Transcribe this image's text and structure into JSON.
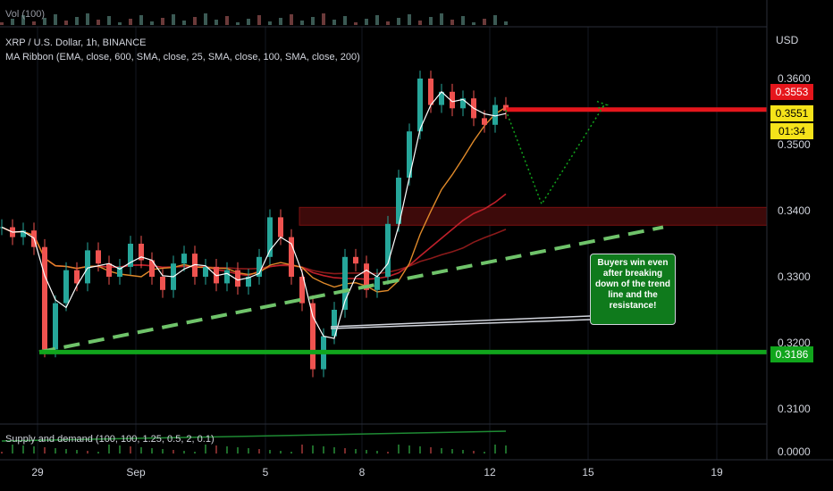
{
  "volume_label": "Vol (100)",
  "symbol_title": "XRP / U.S. Dollar, 1h, BINANCE",
  "indicator_title": "MA Ribbon (EMA, close, 600, SMA, close, 25, SMA, close, 100, SMA, close, 200)",
  "currency": "USD",
  "supply_demand_label": "Supply and demand (100, 100, 1.25, 0.5, 2, 0.1)",
  "annotation_text": "Buyers win even after breaking down of the trend line and the resistance!",
  "price_badges": {
    "resistance": "0.3553",
    "last": "0.3551",
    "countdown": "01:34",
    "support": "0.3186"
  },
  "colors": {
    "resistance": "#e5161c",
    "support": "#11a51c",
    "last_price": "#f5e31a",
    "zone": "#3d0a0a",
    "callout": "#0f7a1c"
  },
  "chart_data": {
    "type": "candlestick",
    "y_axis": {
      "ticks": [
        0.36,
        0.35,
        0.34,
        0.33,
        0.32,
        0.31
      ],
      "tick_labels": [
        "0.3600",
        "0.3500",
        "0.3400",
        "0.3300",
        "0.3200",
        "0.3100"
      ],
      "range": [
        0.3065,
        0.3625
      ]
    },
    "x_axis": {
      "tick_labels": [
        "29",
        "Sep",
        "5",
        "8",
        "12",
        "15",
        "19"
      ]
    },
    "sub_pane_tick": "0.0000",
    "levels": {
      "resistance": 0.3553,
      "support": 0.3186,
      "zone": [
        0.3378,
        0.3405
      ]
    },
    "trend_line": {
      "from": [
        "Aug 29",
        0.3186
      ],
      "to": [
        "Sep 16",
        0.3375
      ]
    },
    "projection": [
      [
        "Sep 12",
        0.3552
      ],
      [
        "Sep 14",
        0.341
      ],
      [
        "Sep 16",
        0.356
      ]
    ],
    "price_series": [
      0.3375,
      0.336,
      0.337,
      0.3345,
      0.319,
      0.326,
      0.331,
      0.329,
      0.334,
      0.332,
      0.33,
      0.3315,
      0.335,
      0.3325,
      0.33,
      0.328,
      0.332,
      0.3335,
      0.33,
      0.3315,
      0.329,
      0.331,
      0.3285,
      0.33,
      0.333,
      0.339,
      0.336,
      0.33,
      0.326,
      0.316,
      0.321,
      0.325,
      0.333,
      0.332,
      0.328,
      0.33,
      0.338,
      0.345,
      0.352,
      0.36,
      0.356,
      0.358,
      0.3555,
      0.357,
      0.354,
      0.353,
      0.356,
      0.3551
    ]
  }
}
